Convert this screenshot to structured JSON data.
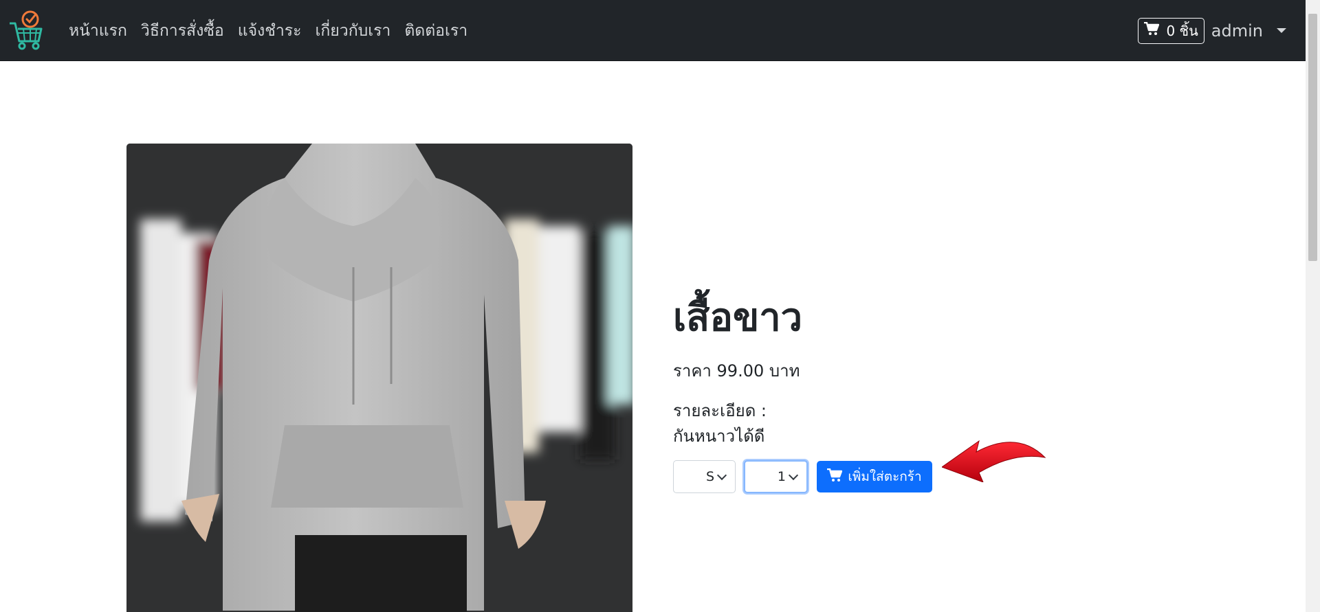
{
  "navbar": {
    "links": [
      {
        "label": "หน้าแรก"
      },
      {
        "label": "วิธีการสั่งซื้อ"
      },
      {
        "label": "แจ้งชำระ"
      },
      {
        "label": "เกี่ยวกับเรา"
      },
      {
        "label": "ติดต่อเรา"
      }
    ],
    "cart_label": "0 ชิ้น",
    "user_label": "admin"
  },
  "product": {
    "title": "เสื้อขาว",
    "price_label": "ราคา 99.00 บาท",
    "description_label": "รายละเอียด :",
    "description": "กันหนาวได้ดี",
    "size_selected": "S",
    "quantity_selected": "1",
    "add_to_cart_label": "เพิ่มใส่ตะกร้า"
  },
  "colors": {
    "navbar_bg": "#212529",
    "primary_button": "#0d6efd",
    "annotation_arrow": "#e3151e"
  },
  "icons": [
    "basket-logo-icon",
    "cart-icon",
    "chevron-down-icon",
    "red-arrow-icon"
  ]
}
